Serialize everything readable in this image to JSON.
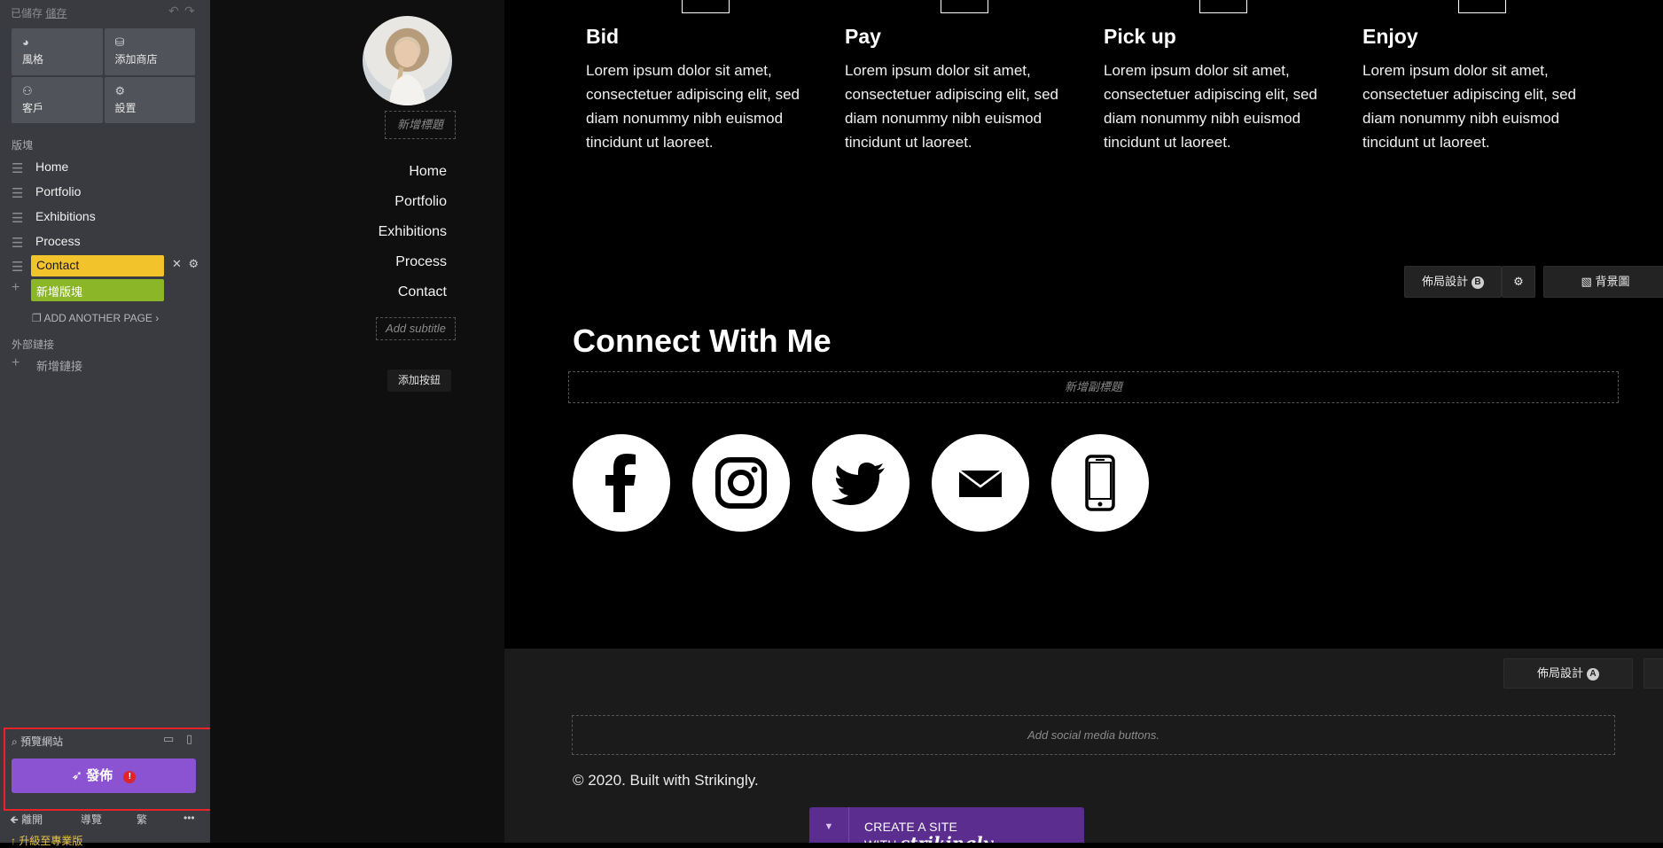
{
  "editor": {
    "save_status": "已儲存",
    "save_link": "儲存",
    "undo_icon": "undo-icon",
    "redo_icon": "redo-icon",
    "tiles": [
      {
        "icon": "palette-icon",
        "label": "風格"
      },
      {
        "icon": "store-icon",
        "label": "添加商店"
      },
      {
        "icon": "users-icon",
        "label": "客戶"
      },
      {
        "icon": "gear-icon",
        "label": "設置"
      }
    ],
    "sections_label": "版塊",
    "pages": [
      "Home",
      "Portfolio",
      "Exhibitions",
      "Process",
      "Contact"
    ],
    "add_section": "新增版塊",
    "add_another_page": "ADD ANOTHER PAGE ›",
    "external_links_label": "外部鏈接",
    "add_link": "新增鏈接",
    "preview_site": "預覽網站",
    "publish": "發佈",
    "publish_alert": "!",
    "footer_tools": [
      "🡸 離開",
      "導覽",
      "繁",
      "•••"
    ],
    "upgrade": "↑ 升級至專業版"
  },
  "sitenav": {
    "add_title_placeholder": "新增標題",
    "links": [
      "Home",
      "Portfolio",
      "Exhibitions",
      "Process",
      "Contact"
    ],
    "add_subtitle_placeholder": "Add subtitle",
    "add_button": "添加按鈕"
  },
  "process": {
    "steps": [
      {
        "title": "Bid",
        "text": "Lorem ipsum dolor sit amet, consectetuer adipiscing elit, sed diam nonummy nibh euismod tincidunt ut laoreet."
      },
      {
        "title": "Pay",
        "text": "Lorem ipsum dolor sit amet, consectetuer adipiscing elit, sed diam nonummy nibh euismod tincidunt ut laoreet."
      },
      {
        "title": "Pick up",
        "text": "Lorem ipsum dolor sit amet, consectetuer adipiscing elit, sed diam nonummy nibh euismod tincidunt ut laoreet."
      },
      {
        "title": "Enjoy",
        "text": "Lorem ipsum dolor sit amet, consectetuer adipiscing elit, sed diam nonummy nibh euismod tincidunt ut laoreet."
      }
    ]
  },
  "contact": {
    "layout_button": "佈局設計",
    "layout_key": "B",
    "background_button": "背景圖",
    "title": "Connect With Me",
    "subtitle_placeholder": "新增副標題",
    "social_icons": [
      "facebook-icon",
      "instagram-icon",
      "twitter-icon",
      "email-icon",
      "phone-icon"
    ]
  },
  "footer": {
    "layout_button": "佈局設計",
    "layout_key": "A",
    "social_placeholder": "Add social media buttons.",
    "copyright": "© 2020. Built with Strikingly.",
    "create_site": "CREATE A SITE WITH",
    "brand": "strikingly"
  },
  "colors": {
    "active_page": "#f3c32c",
    "add_section": "#8bb627",
    "publish": "#8b53d1",
    "highlight_frame": "#e8232a"
  }
}
